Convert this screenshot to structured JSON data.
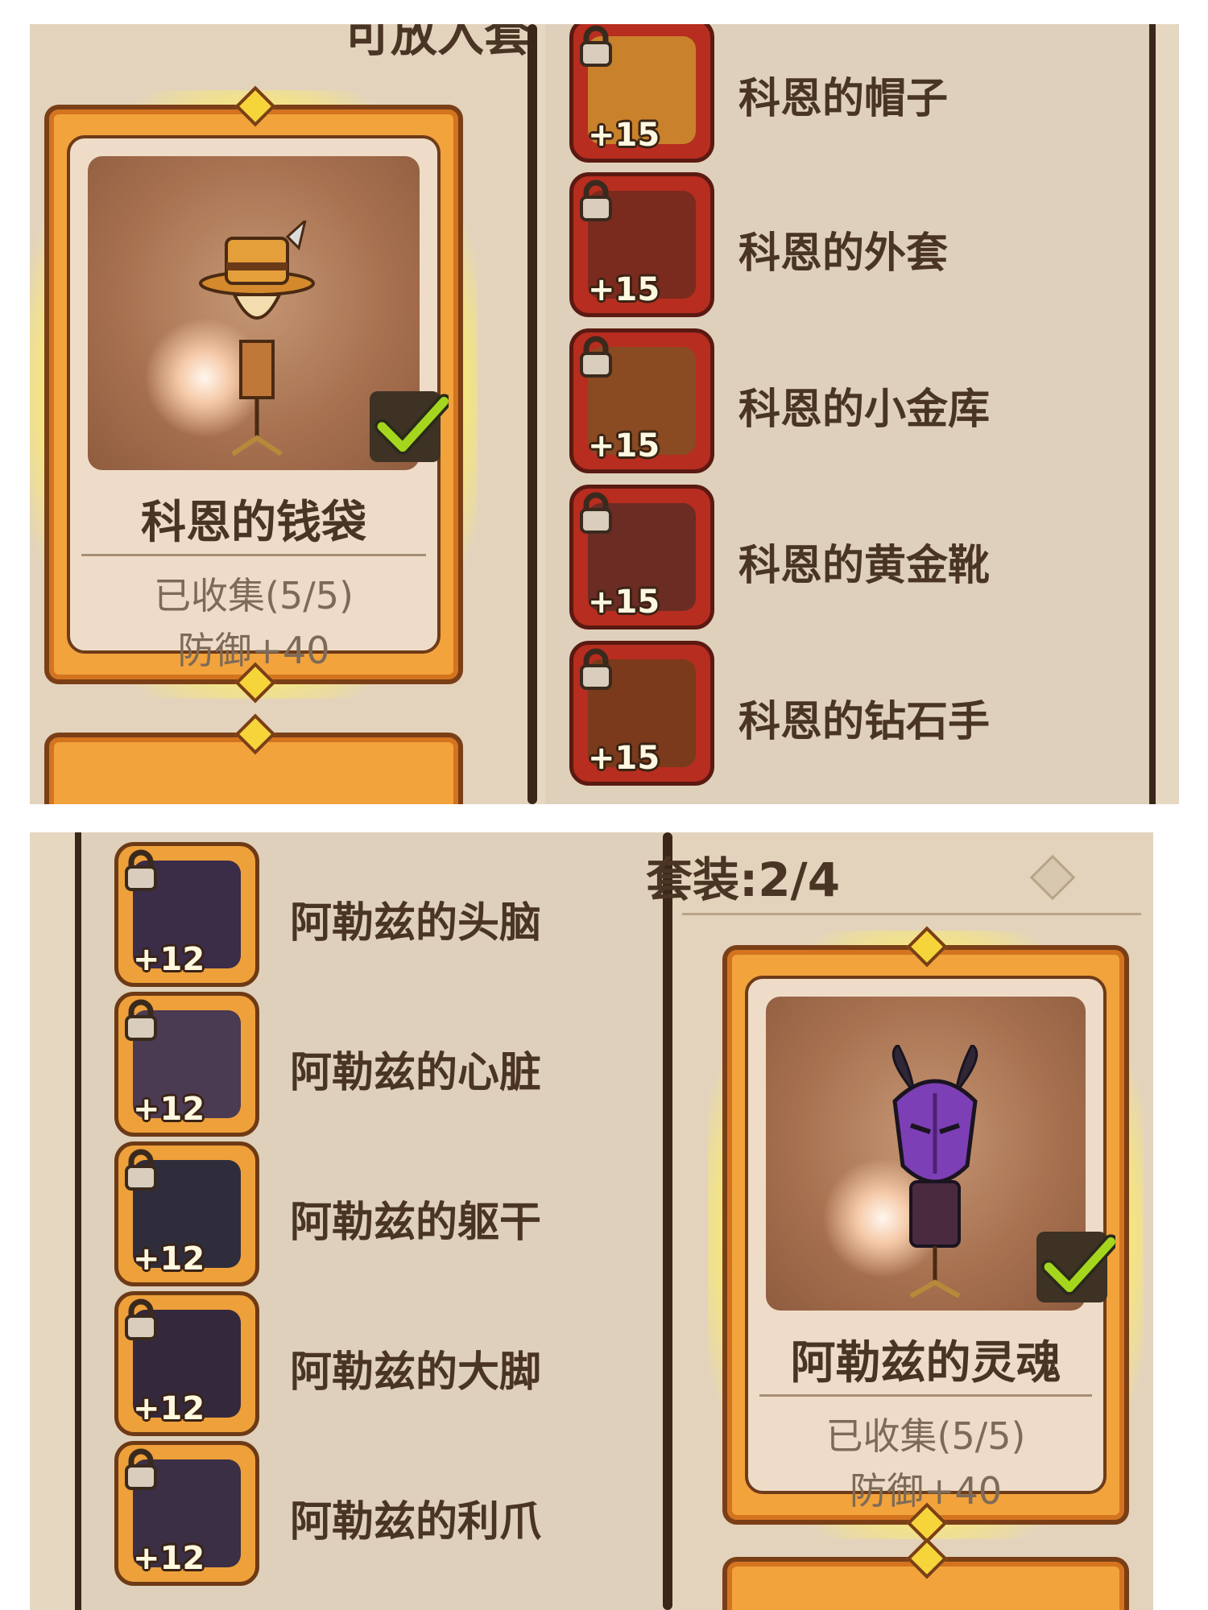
{
  "top_panel": {
    "header_text": "可放入套",
    "card": {
      "title": "科恩的钱袋",
      "collected": "已收集(5/5)",
      "stat": "防御+40",
      "checked": true
    },
    "items": [
      {
        "name": "科恩的帽子",
        "level": "+15",
        "art_color": "#c9822b"
      },
      {
        "name": "科恩的外套",
        "level": "+15",
        "art_color": "#7a2b1e"
      },
      {
        "name": "科恩的小金库",
        "level": "+15",
        "art_color": "#8a4a22"
      },
      {
        "name": "科恩的黄金靴",
        "level": "+15",
        "art_color": "#6b2c24"
      },
      {
        "name": "科恩的钻石手",
        "level": "+15",
        "art_color": "#7b3a1c"
      }
    ]
  },
  "bottom_panel": {
    "set_label": "套装:2/4",
    "card": {
      "title": "阿勒兹的灵魂",
      "collected": "已收集(5/5)",
      "stat": "防御+40",
      "checked": true
    },
    "items": [
      {
        "name": "阿勒兹的头脑",
        "level": "+12",
        "art_color": "#3b2c48"
      },
      {
        "name": "阿勒兹的心脏",
        "level": "+12",
        "art_color": "#4a3a52"
      },
      {
        "name": "阿勒兹的躯干",
        "level": "+12",
        "art_color": "#2f2d3c"
      },
      {
        "name": "阿勒兹的大脚",
        "level": "+12",
        "art_color": "#34283c"
      },
      {
        "name": "阿勒兹的利爪",
        "level": "+12",
        "art_color": "#3a2f44"
      }
    ]
  },
  "colors": {
    "panel_bg": "#e6d7c1",
    "frame_orange": "#f2a33c",
    "badge_red": "#b72d1f",
    "badge_orange": "#eea03a",
    "text_dark": "#4a3524",
    "check_green": "#a5d61e"
  },
  "icons": [
    "lock-icon",
    "check-icon",
    "gem-icon",
    "glow-orb-icon"
  ]
}
